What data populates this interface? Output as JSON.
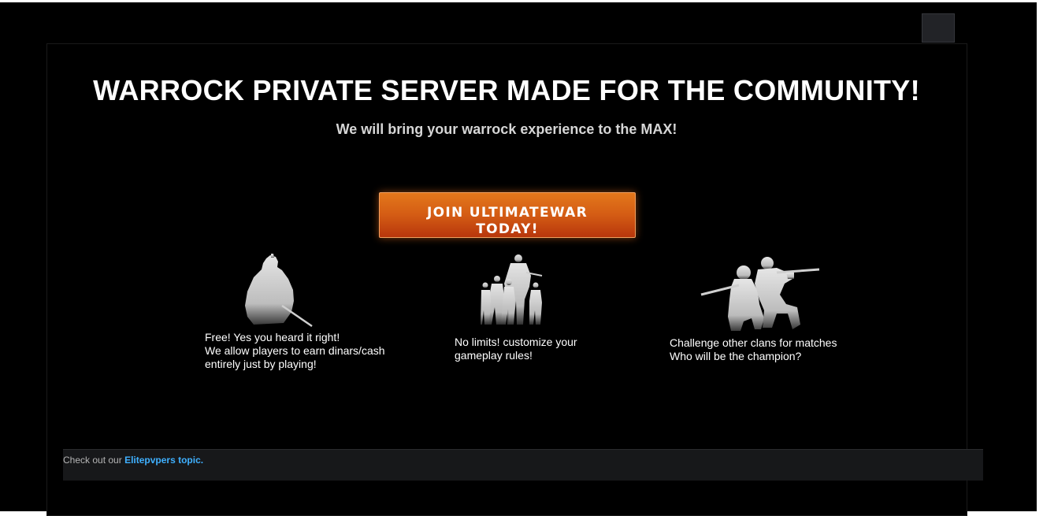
{
  "hero": {
    "title": "WARROCK PRIVATE SERVER MADE FOR THE COMMUNITY!",
    "subtitle": "We will bring your warrock experience to the MAX!",
    "cta_label": "JOIN ULTIMATEWAR TODAY!",
    "cta_color": "#d45c14"
  },
  "features": [
    {
      "icon": "soldier-silhouette-icon",
      "lines": [
        "Free! Yes you heard it right!",
        "We allow players to earn dinars/cash",
        "entirely just by playing!"
      ]
    },
    {
      "icon": "squad-silhouette-icon",
      "lines": [
        "No limits! customize your",
        "gameplay rules!"
      ]
    },
    {
      "icon": "aiming-soldiers-silhouette-icon",
      "lines": [
        "Challenge other clans for matches",
        "Who will be the champion?"
      ]
    }
  ],
  "footer": {
    "prefix": "Check out our",
    "link_label": "Elitepvpers topic.",
    "link_color": "#3fb0ff"
  }
}
